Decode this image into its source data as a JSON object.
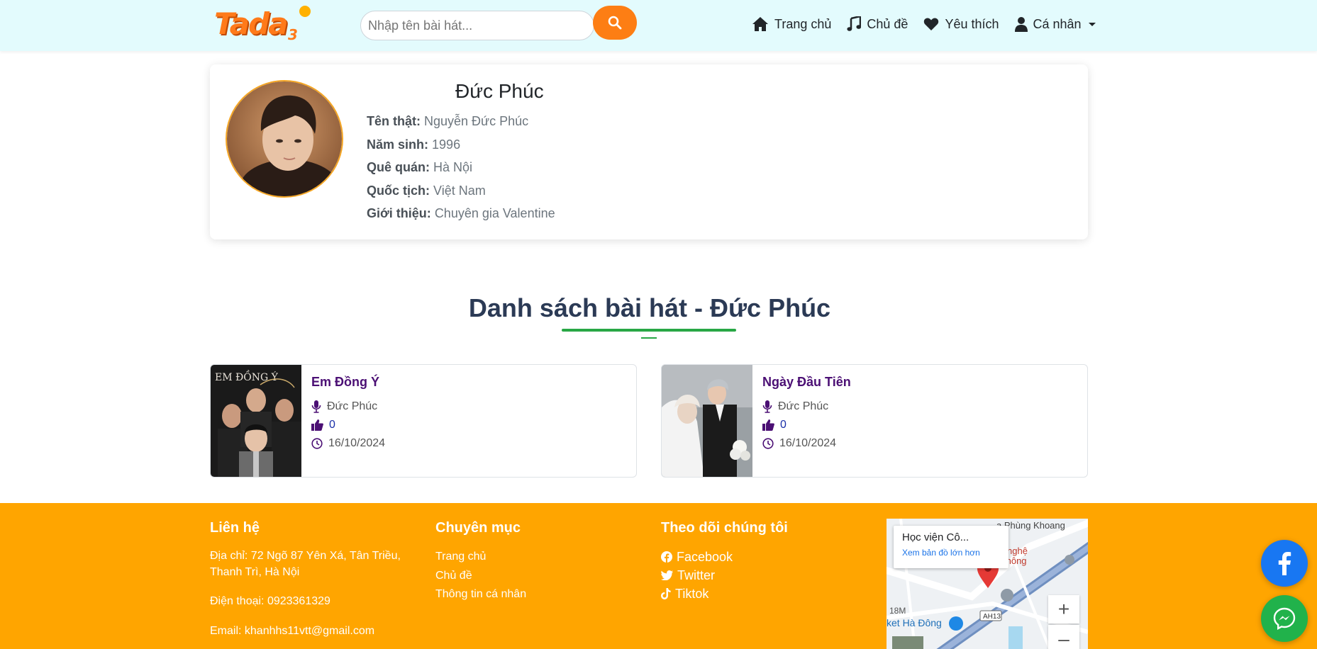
{
  "header": {
    "logo_text": "Tada",
    "search": {
      "placeholder": "Nhập tên bài hát..."
    },
    "nav": [
      {
        "label": "Trang chủ",
        "icon": "home-icon"
      },
      {
        "label": "Chủ đề",
        "icon": "music-note-icon"
      },
      {
        "label": "Yêu thích",
        "icon": "heart-icon"
      },
      {
        "label": "Cá nhân",
        "icon": "user-icon"
      }
    ]
  },
  "profile": {
    "name": "Đức Phúc",
    "fields": [
      {
        "label": "Tên thật:",
        "value": "Nguyễn Đức Phúc"
      },
      {
        "label": "Năm sinh:",
        "value": "1996"
      },
      {
        "label": "Quê quán:",
        "value": "Hà Nội"
      },
      {
        "label": "Quốc tịch:",
        "value": "Việt Nam"
      },
      {
        "label": "Giới thiệu:",
        "value": "Chuyên gia Valentine"
      }
    ]
  },
  "songs_section": {
    "title": "Danh sách bài hát - Đức Phúc",
    "songs": [
      {
        "title": "Em Đồng Ý",
        "artist": "Đức Phúc",
        "likes": "0",
        "date": "16/10/2024",
        "cover_text": "EM ĐỒNG Ý"
      },
      {
        "title": "Ngày Đầu Tiên",
        "artist": "Đức Phúc",
        "likes": "0",
        "date": "16/10/2024"
      }
    ]
  },
  "footer": {
    "contact": {
      "heading": "Liên hệ",
      "address": "Địa chỉ: 72 Ngõ 87 Yên Xá, Tân Triều, Thanh Trì, Hà Nội",
      "phone": "Điện thoại: 0923361329",
      "email": "Email: khanhhs11vtt@gmail.com"
    },
    "categories": {
      "heading": "Chuyên mục",
      "links": [
        "Trang chủ",
        "Chủ đề",
        "Thông tin cá nhân"
      ]
    },
    "follow": {
      "heading": "Theo dõi chúng tôi",
      "links": [
        "Facebook",
        "Twitter",
        "Tiktok"
      ]
    },
    "map": {
      "place": "Học viện Cô...",
      "link": "Xem bản đồ lớn hơn",
      "labels": [
        "a Phùng Khoang",
        "nghệ",
        "thông",
        "18M",
        "ket Hà Đông",
        "AH13"
      ],
      "zoom_in": "+",
      "zoom_out": "–"
    }
  },
  "colors": {
    "navbar_bg": "#e3fbfd",
    "accent_orange": "#fd7e14",
    "footer_bg": "#ffa500",
    "title_underline": "#28a745",
    "song_title": "#4b0f74",
    "facebook_blue": "#1877f2",
    "messenger_green": "#21b24b"
  }
}
